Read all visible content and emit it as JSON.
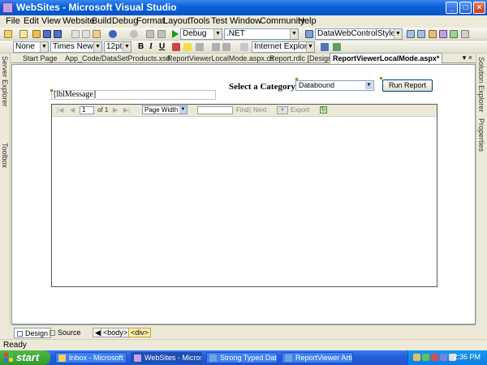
{
  "window": {
    "title": "WebSites - Microsoft Visual Studio",
    "min_glyph": "_",
    "max_glyph": "□",
    "close_glyph": "×"
  },
  "menu": [
    "File",
    "Edit",
    "View",
    "Website",
    "Build",
    "Debug",
    "Format",
    "Layout",
    "Tools",
    "Test",
    "Window",
    "Community",
    "Help"
  ],
  "toolbar1": {
    "config": "Debug",
    "platform": ".NET",
    "project": "DataWebControlStyle"
  },
  "toolbar2": {
    "block_format": "None",
    "font": "Times New Ror",
    "size": "12pt",
    "bold": "B",
    "italic": "I",
    "underline": "U",
    "target": "Internet Explorer 6.0"
  },
  "side": {
    "left": [
      "Server Explorer",
      "Toolbox"
    ],
    "right": [
      "Solution Explorer",
      "Properties"
    ]
  },
  "tabs": [
    {
      "label": "Start Page",
      "active": false
    },
    {
      "label": "App_Code/DataSetProducts.xsd",
      "active": false
    },
    {
      "label": "ReportViewerLocalMode.aspx.cs",
      "active": false
    },
    {
      "label": "Report.rdlc [Design]",
      "active": false
    },
    {
      "label": "ReportViewerLocalMode.aspx*",
      "active": true
    }
  ],
  "tab_controls": "▾ ×",
  "form": {
    "category_label": "Select a Category :",
    "category_value": "Databound",
    "run_button": "Run Report",
    "message_label": "[lblMessage]"
  },
  "viewer": {
    "page": "1",
    "of_label": "of 1",
    "zoom": "Page Width",
    "find": "Find",
    "separator": "|",
    "next": "Next",
    "export": "Export"
  },
  "viewbar": {
    "design": "Design",
    "source": "Source",
    "crumbs": [
      "<body>",
      "<div>"
    ]
  },
  "status": "Ready",
  "taskbar": {
    "start": "start",
    "items": [
      {
        "label": "Inbox - Microsoft ...",
        "active": false
      },
      {
        "label": "WebSites - Micros...",
        "active": true
      },
      {
        "label": "Strong Typed Dat...",
        "active": false
      },
      {
        "label": "ReportViewer Arti...",
        "active": false
      }
    ],
    "clock": "2:36 PM"
  },
  "colors": {
    "titlebar": "#0a5fd8",
    "taskbar": "#245edb",
    "start": "#2f9a2b",
    "chrome": "#ece9d8"
  }
}
